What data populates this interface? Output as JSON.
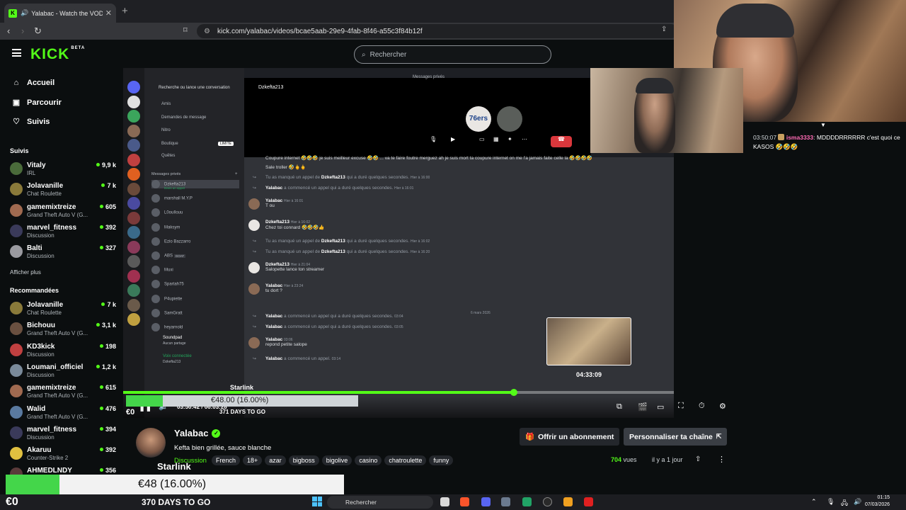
{
  "browser": {
    "tab_title": "Yalabac - Watch the VOD on",
    "url": "kick.com/yalabac/videos/bcae5aab-29e9-4fab-8f46-a55c3f84b12f"
  },
  "kick": {
    "logo": "KICK",
    "logo_sup": "BETA",
    "search_placeholder": "Rechercher"
  },
  "sidebar": {
    "nav": [
      {
        "label": "Accueil",
        "icon": "home-icon"
      },
      {
        "label": "Parcourir",
        "icon": "browse-icon"
      },
      {
        "label": "Suivis",
        "icon": "heart-icon"
      }
    ],
    "followed_header": "Suivis",
    "followed": [
      {
        "name": "Vitaly",
        "category": "IRL",
        "viewers": "9,9 k",
        "color": "#4a6b3a"
      },
      {
        "name": "Jolavanille",
        "category": "Chat Roulette",
        "viewers": "7 k",
        "color": "#8a7a3a"
      },
      {
        "name": "gamemixtreize",
        "category": "Grand Theft Auto V (G...",
        "viewers": "605",
        "color": "#a06a50"
      },
      {
        "name": "marvel_fitness",
        "category": "Discussion",
        "viewers": "392",
        "color": "#3a3a5a"
      },
      {
        "name": "Balti",
        "category": "Discussion",
        "viewers": "327",
        "color": "#9a9aa0"
      }
    ],
    "show_more": "Afficher plus",
    "recommended_header": "Recommandées",
    "recommended": [
      {
        "name": "Jolavanille",
        "category": "Chat Roulette",
        "viewers": "7 k",
        "color": "#8a7a3a"
      },
      {
        "name": "Bichouu",
        "category": "Grand Theft Auto V (G...",
        "viewers": "3,1 k",
        "color": "#6a5040"
      },
      {
        "name": "KD3kick",
        "category": "Discussion",
        "viewers": "198",
        "color": "#c04040"
      },
      {
        "name": "Loumani_officiel",
        "category": "Discussion",
        "viewers": "1,2 k",
        "color": "#7a8a9a"
      },
      {
        "name": "gamemixtreize",
        "category": "Grand Theft Auto V (G...",
        "viewers": "615",
        "color": "#a06a50"
      },
      {
        "name": "Walid",
        "category": "Grand Theft Auto V (G...",
        "viewers": "476",
        "color": "#5a7aa0"
      },
      {
        "name": "marvel_fitness",
        "category": "Discussion",
        "viewers": "394",
        "color": "#3a3a5a"
      },
      {
        "name": "Akaruu",
        "category": "Counter-Strike 2",
        "viewers": "392",
        "color": "#e0c040"
      },
      {
        "name": "AHMEDLNDY",
        "category": "",
        "viewers": "356",
        "color": "#5a3a3a"
      }
    ]
  },
  "discord": {
    "call_header": "Messages privés",
    "search_conv": "Recherche ou lance une conversation",
    "menu": [
      "Amis",
      "Demandes de message",
      "Nitro",
      "Boutique",
      "Quêtes"
    ],
    "limited_badge": "LIMITÉ",
    "dm_header": "Messages privés",
    "dms": [
      "Dzkefta213",
      "marshall M.Y.P",
      "L0ouIlouu",
      "Maksym",
      "Ezio Bazzarro",
      "ABS",
      "Muxi",
      "Spartah75",
      "P4upiette",
      "SamGratt",
      "heyarnold"
    ],
    "dm_sub": "Dans un appel",
    "goat_badge": "GOAT",
    "new_badge": "NOUVEAU",
    "activity": "Soundpad",
    "activity_sub": "Aucun partage",
    "voice": "Voix connectée",
    "voice_sub": "Dzkefta213",
    "chat_user": "Dzkefta213",
    "avatar_label": "76ers",
    "date_sep": "6 mars 2026",
    "messages": [
      {
        "type": "text",
        "text": "Coupure internet 🤣🤣🤣 je suis meilleur excuse 🤣🤣 ... va te faire foutre merguez ah je suis mort ta coupure internet on me l'a jamais faite celle la 🤣🤣🤣🤣"
      },
      {
        "type": "text",
        "text": "Sale troller 🤣🖕🖕"
      },
      {
        "type": "sys",
        "user": "Dzkefta213",
        "text": "Tu as manqué un appel de",
        "rest": "qui a duré quelques secondes.",
        "time": "Hier à 16:00"
      },
      {
        "type": "sys",
        "user": "Yalabac",
        "text": "",
        "rest": "a commencé un appel qui a duré quelques secondes.",
        "time": "Hier à 16:01"
      },
      {
        "type": "head",
        "user": "Yalabac",
        "time": "Hier à 16:01",
        "text": "T ou"
      },
      {
        "type": "head",
        "user": "Dzkefta213",
        "time": "Hier à 16:02",
        "text": "Chez toi connard 🤣🤣🤣👍"
      },
      {
        "type": "sys",
        "user": "Dzkefta213",
        "text": "Tu as manqué un appel de",
        "rest": "qui a duré quelques secondes.",
        "time": "Hier à 16:02"
      },
      {
        "type": "sys",
        "user": "Dzkefta213",
        "text": "Tu as manqué un appel de",
        "rest": "qui a duré quelques secondes.",
        "time": "Hier à 16:20"
      },
      {
        "type": "head",
        "user": "Dzkefta213",
        "time": "Hier à 21:04",
        "text": "Salopette lance ton streamer"
      },
      {
        "type": "head",
        "user": "Yalabac",
        "time": "Hier à 23:24",
        "text": "tu dort ?"
      },
      {
        "type": "sys",
        "user": "Yalabac",
        "text": "",
        "rest": "a commencé un appel qui a duré quelques secondes.",
        "time": "03:04"
      },
      {
        "type": "sys",
        "user": "Yalabac",
        "text": "",
        "rest": "a commencé un appel qui a duré quelques secondes.",
        "time": "03:05"
      },
      {
        "type": "head",
        "user": "Yalabac",
        "time": "03:06",
        "text": "repond petite salope"
      },
      {
        "type": "sys",
        "user": "Yalabac",
        "text": "",
        "rest": "a commencé un appel.",
        "time": "03:14"
      }
    ]
  },
  "player": {
    "progress": 0.71,
    "hover": 0.84,
    "current_time": "03:50:42",
    "duration": "06:03:28",
    "hover_time": "04:33:09"
  },
  "overlay": {
    "goal_text": "€48.00 (16.00%)",
    "goal_zero": "€0",
    "goal_days": "371 DAYS TO GO",
    "starlink": "Starlink",
    "goal_fraction": 0.16
  },
  "chat": {
    "timestamp": "03:50:07",
    "user": "isma3333",
    "message": "MDDDDRRRRRR c'est quoi ce KASOS 🤣🤣🤣"
  },
  "stream": {
    "name": "Yalabac",
    "title": "Kefta bien grillée, sauce blanche",
    "category": "Discussion",
    "tags": [
      "French",
      "18+",
      "azar",
      "bigboss",
      "bigolive",
      "casino",
      "chatroulette",
      "funny"
    ],
    "subscribe": "Offrir un abonnement",
    "customize": "Personnaliser ta chaîne",
    "views": "704",
    "views_label": "vues",
    "ago": "il y a 1 jour"
  },
  "bottom_overlay": {
    "goal_text": "€48 (16.00%)",
    "zero": "€0",
    "days": "370 DAYS TO GO",
    "starlink": "Starlink",
    "goal_fraction": 0.16
  },
  "taskbar": {
    "search": "Rechercher",
    "time": "01:15",
    "date": "07/03/2026"
  },
  "colors": {
    "kick_green": "#53fc18",
    "bg": "#0b0e0f",
    "discord_bg": "#313338"
  }
}
